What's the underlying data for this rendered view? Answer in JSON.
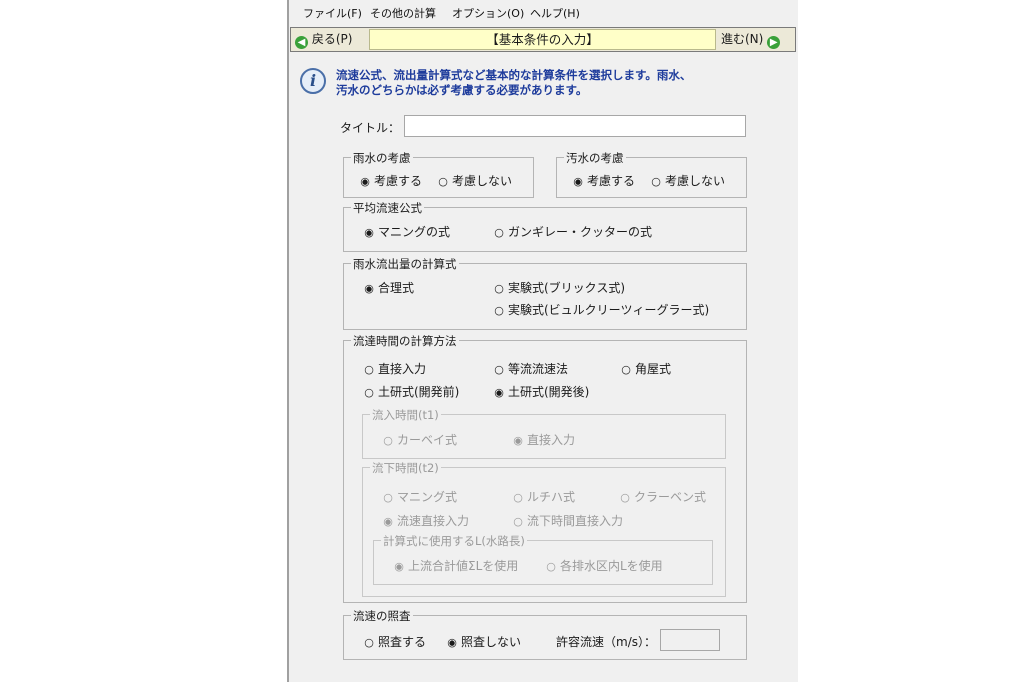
{
  "menubar": {
    "items": [
      "ファイル(F)",
      "その他の計算",
      "オプション(O)",
      "ヘルプ(H)"
    ]
  },
  "nav": {
    "back": "戻る(P)",
    "title": "【基本条件の入力】",
    "next": "進む(N)",
    "back_icon": "left-arrow-icon",
    "next_icon": "right-arrow-icon"
  },
  "info": {
    "icon": "info-icon",
    "line1": "流速公式、流出量計算式など基本的な計算条件を選択します。雨水、",
    "line2": "汚水のどちらかは必ず考慮する必要があります。"
  },
  "title_field": {
    "label": "タイトル：",
    "value": ""
  },
  "rain": {
    "title": "雨水の考慮",
    "options": [
      "考慮する",
      "考慮しない"
    ],
    "selected": "考慮する"
  },
  "sewage": {
    "title": "汚水の考慮",
    "options": [
      "考慮する",
      "考慮しない"
    ],
    "selected": "考慮する"
  },
  "velocity_formula": {
    "title": "平均流速公式",
    "options": [
      "マニングの式",
      "ガンギレー・クッターの式"
    ],
    "selected": "マニングの式"
  },
  "runoff": {
    "title": "雨水流出量の計算式",
    "options": [
      "合理式",
      "実験式(ブリックス式)",
      "実験式(ビュルクリーツィーグラー式)"
    ],
    "selected": "合理式"
  },
  "arrival": {
    "title": "流達時間の計算方法",
    "options": [
      "直接入力",
      "等流流速法",
      "角屋式",
      "土研式(開発前)",
      "土研式(開発後)"
    ],
    "selected": "土研式(開発後)",
    "inflow": {
      "title": "流入時間(t1)",
      "options": [
        "カーベイ式",
        "直接入力"
      ],
      "selected": "直接入力"
    },
    "flow": {
      "title": "流下時間(t2)",
      "options": [
        "マニング式",
        "ルチハ式",
        "クラーベン式",
        "流速直接入力",
        "流下時間直接入力"
      ],
      "selected": "流速直接入力",
      "length": {
        "title": "計算式に使用するL(水路長)",
        "options": [
          "上流合計値ΣLを使用",
          "各排水区内Lを使用"
        ],
        "selected": "上流合計値ΣLを使用"
      }
    }
  },
  "check": {
    "title": "流速の照査",
    "options": [
      "照査する",
      "照査しない"
    ],
    "selected": "照査しない",
    "allow_label": "許容流速（m/s）：",
    "allow_value": ""
  }
}
